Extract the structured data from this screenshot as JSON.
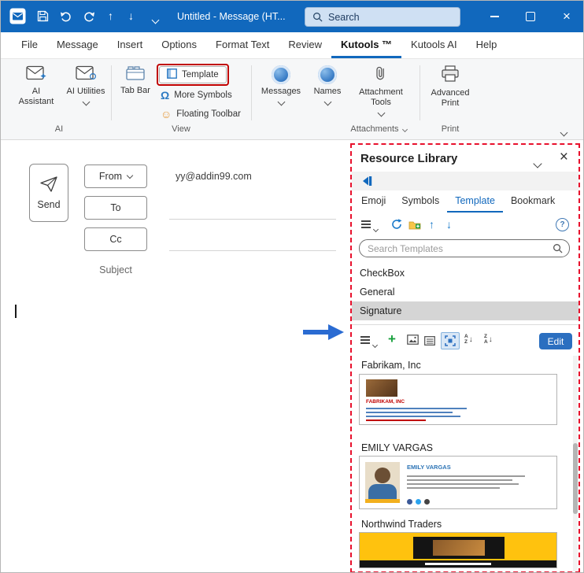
{
  "titlebar": {
    "title": "Untitled  -  Message (HT...",
    "search_placeholder": "Search"
  },
  "menubar": {
    "tabs": [
      "File",
      "Message",
      "Insert",
      "Options",
      "Format Text",
      "Review",
      "Kutools ™",
      "Kutools AI",
      "Help"
    ],
    "active_tab": "Kutools ™"
  },
  "ribbon": {
    "ai_assistant": "AI Assistant",
    "ai_utilities": "AI Utilities",
    "ai_group_label": "AI",
    "tab_bar": "Tab Bar",
    "template": "Template",
    "more_symbols": "More Symbols",
    "floating_toolbar": "Floating Toolbar",
    "view_group_label": "View",
    "messages": "Messages",
    "names": "Names",
    "attachment_tools": "Attachment Tools",
    "attachments_group_label": "Attachments",
    "advanced_print": "Advanced Print",
    "print_group_label": "Print"
  },
  "compose": {
    "send": "Send",
    "from": "From",
    "from_value": "yy@addin99.com",
    "to": "To",
    "cc": "Cc",
    "subject": "Subject"
  },
  "pane": {
    "title": "Resource Library",
    "tabs": [
      "Emoji",
      "Symbols",
      "Template",
      "Bookmark"
    ],
    "active_tab": "Template",
    "search_placeholder": "Search Templates",
    "folders": [
      "CheckBox",
      "General",
      "Signature"
    ],
    "selected_folder": "Signature",
    "edit": "Edit",
    "templates": [
      "Fabrikam, Inc",
      "EMILY VARGAS",
      "Northwind Traders"
    ],
    "fabrikam_card_name": "FABRIKAM, INC",
    "emily_card_name": "EMILY VARGAS"
  },
  "icons": {
    "omega": "Ω",
    "smiley": "☺",
    "question": "?",
    "plus": "+",
    "up_arrow": "↑",
    "down_arrow": "↓",
    "multiply": "×",
    "sort_a": "A",
    "sort_z": "Z"
  },
  "colors": {
    "titlebar_blue": "#1168bd",
    "accent_blue": "#1168bd",
    "annotation_red": "#e8112d",
    "selection_gray": "#d5d5d5",
    "edit_button_blue": "#2b6fc0"
  }
}
